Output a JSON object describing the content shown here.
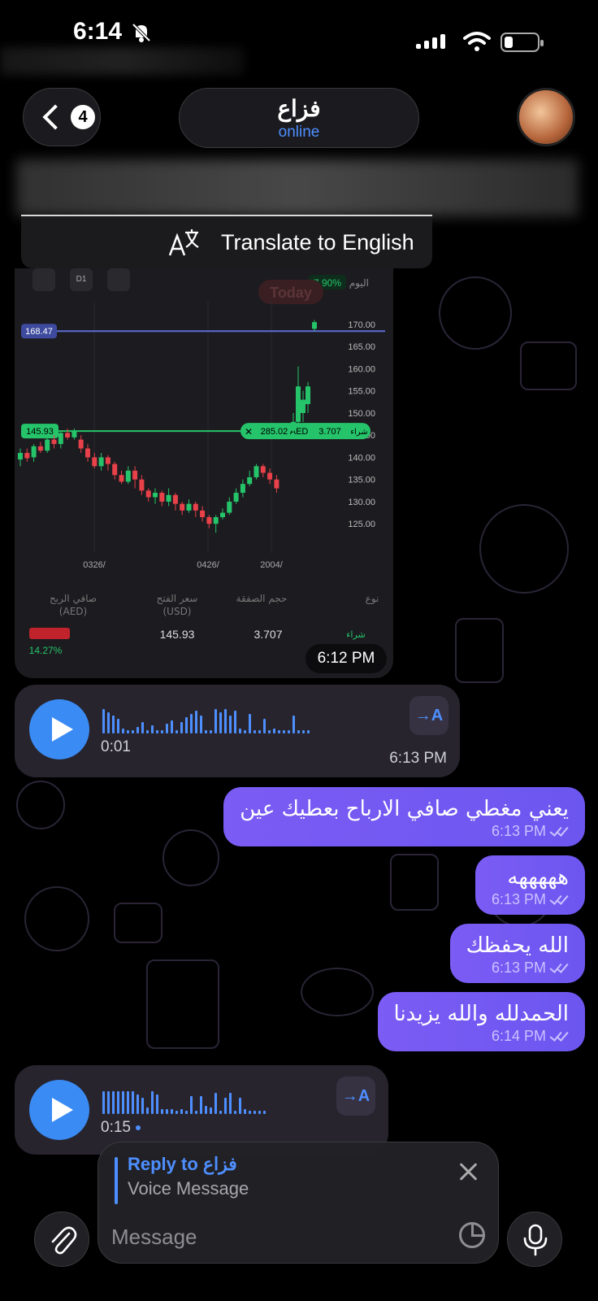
{
  "status_bar": {
    "time": "6:14"
  },
  "header": {
    "back_count": "4",
    "contact_name": "فزاع",
    "contact_status": "online"
  },
  "translate_bar": {
    "label": "Translate to English"
  },
  "chart_message": {
    "timestamp": "6:12 PM",
    "top_label": "اليوم",
    "change_pct": "7.90%",
    "today_label": "Today",
    "line_168": "168.47",
    "entry_line": "145.93",
    "order_value": "285.02 AED",
    "order_qty": "3.707",
    "order_side": "شراء",
    "footer": {
      "headers": [
        "صافي الربح\n(AED)",
        "سعر الفتح\n(USD)",
        "حجم الصفقة",
        "نوع"
      ],
      "profit_pct": "14.27%",
      "open_price": "145.93",
      "volume": "3.707",
      "type": "شراء"
    },
    "toolbar_icons": [
      "expand-icon",
      "timeframe-icon",
      "indicator-icon"
    ],
    "timeframe": "D1"
  },
  "chart_data": {
    "type": "candlestick",
    "x_ticks": [
      "0326/",
      "0426/",
      "2004/"
    ],
    "y_ticks": [
      170.0,
      165.0,
      160.0,
      155.0,
      150.0,
      145.0,
      140.0,
      135.0,
      130.0,
      125.0
    ],
    "ylim": [
      121,
      172
    ],
    "reference_lines": [
      {
        "value": 168.47,
        "color": "#5b6cd6"
      },
      {
        "value": 145.93,
        "color": "#25c46a"
      }
    ],
    "candles": [
      {
        "o": 139.5,
        "c": 141.0,
        "h": 142,
        "l": 138
      },
      {
        "o": 141,
        "c": 139.8,
        "h": 142,
        "l": 139
      },
      {
        "o": 140,
        "c": 142.5,
        "h": 143,
        "l": 139
      },
      {
        "o": 142.5,
        "c": 141.5,
        "h": 143.5,
        "l": 141
      },
      {
        "o": 141.5,
        "c": 144,
        "h": 145,
        "l": 141
      },
      {
        "o": 144,
        "c": 143,
        "h": 145,
        "l": 142
      },
      {
        "o": 143,
        "c": 145.5,
        "h": 146,
        "l": 142
      },
      {
        "o": 145.5,
        "c": 144.5,
        "h": 146.5,
        "l": 144
      },
      {
        "o": 144.5,
        "c": 146,
        "h": 146.5,
        "l": 144
      },
      {
        "o": 144,
        "c": 142,
        "h": 145,
        "l": 141
      },
      {
        "o": 142,
        "c": 140,
        "h": 143,
        "l": 139
      },
      {
        "o": 140,
        "c": 138,
        "h": 141,
        "l": 137.5
      },
      {
        "o": 138,
        "c": 140,
        "h": 141,
        "l": 137
      },
      {
        "o": 140,
        "c": 138.5,
        "h": 140.5,
        "l": 137
      },
      {
        "o": 138.5,
        "c": 136,
        "h": 139,
        "l": 135
      },
      {
        "o": 136,
        "c": 134.5,
        "h": 137,
        "l": 134
      },
      {
        "o": 134.5,
        "c": 137,
        "h": 138,
        "l": 134
      },
      {
        "o": 137,
        "c": 135,
        "h": 138,
        "l": 133
      },
      {
        "o": 135,
        "c": 132.5,
        "h": 136,
        "l": 131.5
      },
      {
        "o": 132.5,
        "c": 131,
        "h": 133,
        "l": 130
      },
      {
        "o": 131,
        "c": 132,
        "h": 133,
        "l": 129.5
      },
      {
        "o": 132,
        "c": 130,
        "h": 132.5,
        "l": 129
      },
      {
        "o": 130,
        "c": 131.5,
        "h": 133,
        "l": 129
      },
      {
        "o": 131.5,
        "c": 129.5,
        "h": 132,
        "l": 128
      },
      {
        "o": 129.5,
        "c": 128,
        "h": 130,
        "l": 127
      },
      {
        "o": 128,
        "c": 129.5,
        "h": 130.5,
        "l": 127.5
      },
      {
        "o": 129.5,
        "c": 128,
        "h": 130,
        "l": 126.5
      },
      {
        "o": 128,
        "c": 126.5,
        "h": 129,
        "l": 125.5
      },
      {
        "o": 126.5,
        "c": 125,
        "h": 127,
        "l": 124
      },
      {
        "o": 125,
        "c": 126.5,
        "h": 127,
        "l": 123
      },
      {
        "o": 126.5,
        "c": 127.5,
        "h": 128.5,
        "l": 126
      },
      {
        "o": 127.5,
        "c": 130,
        "h": 131,
        "l": 127
      },
      {
        "o": 130,
        "c": 132,
        "h": 133,
        "l": 129.5
      },
      {
        "o": 132,
        "c": 134,
        "h": 135,
        "l": 131
      },
      {
        "o": 134,
        "c": 135.5,
        "h": 137,
        "l": 133.5
      },
      {
        "o": 135.5,
        "c": 138,
        "h": 138.5,
        "l": 135
      },
      {
        "o": 138,
        "c": 136.5,
        "h": 138.5,
        "l": 135.5
      },
      {
        "o": 136.5,
        "c": 135,
        "h": 137.5,
        "l": 134
      },
      {
        "o": 135,
        "c": 133,
        "h": 136,
        "l": 132
      }
    ],
    "spike_candles": [
      {
        "o": 146,
        "c": 148,
        "h": 150,
        "l": 145
      },
      {
        "o": 148,
        "c": 156,
        "h": 160.5,
        "l": 147
      },
      {
        "o": 150,
        "c": 153,
        "h": 155,
        "l": 148
      },
      {
        "o": 152,
        "c": 156,
        "h": 157,
        "l": 150
      },
      {
        "o": 169,
        "c": 170.5,
        "h": 171,
        "l": 168.5
      }
    ],
    "colors": {
      "up": "#25c46a",
      "down": "#e8414a"
    }
  },
  "voice_1": {
    "duration": "0:01",
    "timestamp": "6:13 PM",
    "transcribe": "→A"
  },
  "outgoing": [
    {
      "text": "يعني مغطي صافي الارباح بعطيك عين",
      "time": "6:13 PM"
    },
    {
      "text": "هههههه",
      "time": "6:13 PM"
    },
    {
      "text": "الله يحفظك",
      "time": "6:13 PM"
    },
    {
      "text": "الحمدلله والله يزيدنا",
      "time": "6:14 PM"
    }
  ],
  "voice_2": {
    "duration": "0:15",
    "transcribe": "→A"
  },
  "reply": {
    "title": "Reply to فزاع",
    "subtitle": "Voice Message"
  },
  "composer": {
    "placeholder": "Message"
  },
  "colors": {
    "accent": "#4e8fff",
    "outgoing": "#7b5cf4",
    "incoming": "#27242e"
  }
}
